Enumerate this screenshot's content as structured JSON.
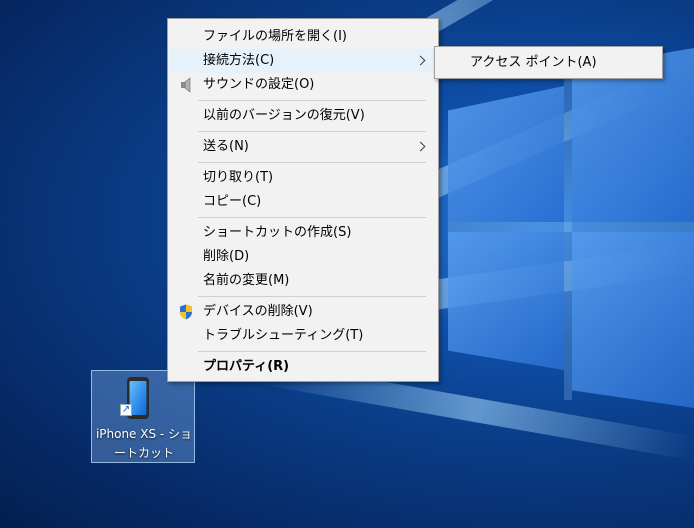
{
  "menu": {
    "items": [
      {
        "label": "ファイルの場所を開く(I)"
      },
      {
        "label": "接続方法(C)"
      },
      {
        "label": "サウンドの設定(O)"
      },
      {
        "label": "以前のバージョンの復元(V)"
      },
      {
        "label": "送る(N)"
      },
      {
        "label": "切り取り(T)"
      },
      {
        "label": "コピー(C)"
      },
      {
        "label": "ショートカットの作成(S)"
      },
      {
        "label": "削除(D)"
      },
      {
        "label": "名前の変更(M)"
      },
      {
        "label": "デバイスの削除(V)"
      },
      {
        "label": "トラブルシューティング(T)"
      },
      {
        "label": "プロパティ(R)"
      }
    ]
  },
  "submenu": {
    "items": [
      {
        "label": "アクセス ポイント(A)"
      }
    ]
  },
  "desktop_icon": {
    "label_line1": "iPhone XS - ショ",
    "label_line2": "ートカット",
    "icon": "phone-icon"
  },
  "colors": {
    "menu_bg": "#f2f2f2",
    "highlight": "#e5f1fb",
    "desktop_dark": "#062a66",
    "desktop_light": "#2a78d8"
  }
}
